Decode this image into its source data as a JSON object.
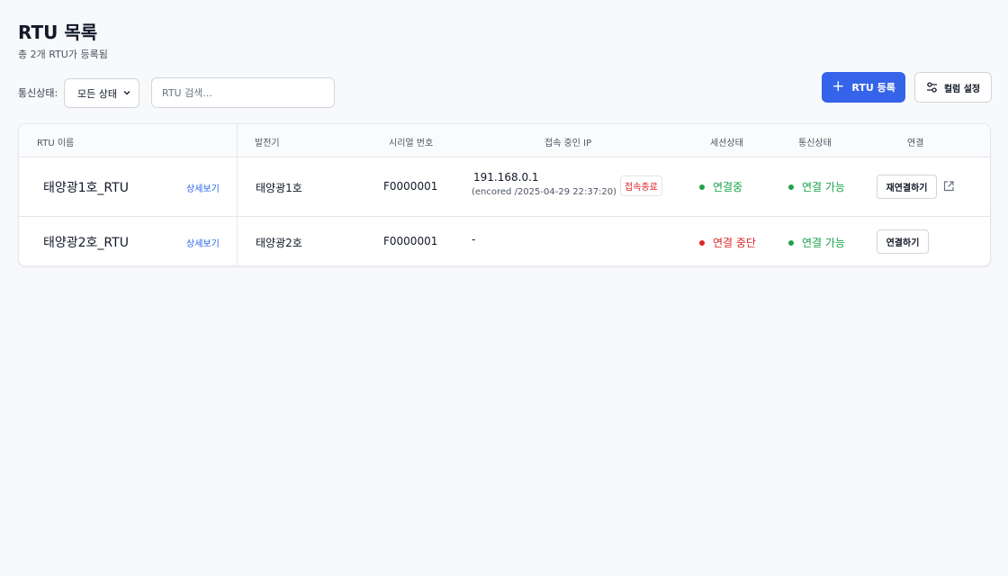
{
  "header": {
    "title": "RTU 목록",
    "subtitle": "총 2개 RTU가 등록됨"
  },
  "filters": {
    "status_label": "통신상태:",
    "status_selected": "모든 상태",
    "search_placeholder": "RTU 검색..."
  },
  "actions": {
    "add_label": "RTU 등록",
    "columns_label": "컬럼 설정"
  },
  "table": {
    "columns": [
      "RTU 이름",
      "발전기",
      "시리얼 번호",
      "접속 중인 IP",
      "세션상태",
      "통신상태",
      "연결"
    ],
    "rows": [
      {
        "name": "태양광1호_RTU",
        "detail": "상세보기",
        "generator": "태양광1호",
        "serial": "F0000001",
        "ip": "191.168.0.1",
        "ip_sub": "(encored /2025-04-29 22:37:20)",
        "ip_badge": "접속종료",
        "session": "연결중",
        "comm": "연결 가능",
        "action": "재연결하기"
      },
      {
        "name": "태양광2호_RTU",
        "detail": "상세보기",
        "generator": "태양광2호",
        "serial": "F0000001",
        "ip": "-",
        "session": "연결 중단",
        "comm": "연결 가능",
        "action": "연결하기"
      }
    ]
  },
  "icons": {
    "add": "plus-icon",
    "columns": "sliders-icon",
    "select": "chevron-down-icon",
    "external": "external-link-icon"
  },
  "colors": {
    "primary": "#3563e9",
    "link": "#2563eb",
    "ok": "#16a34a",
    "ok_dot": "#22a04a",
    "error": "#dc2626",
    "background": "#f8f9fb"
  }
}
